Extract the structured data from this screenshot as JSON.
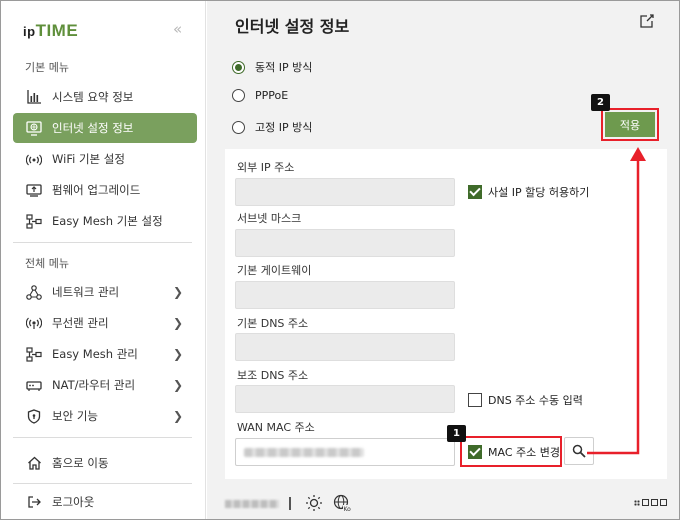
{
  "brand": {
    "ip": "ip",
    "time": "TIME"
  },
  "sidebar": {
    "basic_label": "기본 메뉴",
    "basic_items": [
      {
        "label": "시스템 요약 정보",
        "icon": "chart-icon"
      },
      {
        "label": "인터넷 설정 정보",
        "icon": "globe-icon",
        "active": true
      },
      {
        "label": "WiFi 기본 설정",
        "icon": "wifi-icon"
      },
      {
        "label": "펌웨어 업그레이드",
        "icon": "upgrade-icon"
      },
      {
        "label": "Easy Mesh 기본 설정",
        "icon": "mesh-icon"
      }
    ],
    "all_label": "전체 메뉴",
    "all_items": [
      {
        "label": "네트워크 관리",
        "icon": "network-icon"
      },
      {
        "label": "무선랜 관리",
        "icon": "wireless-icon"
      },
      {
        "label": "Easy Mesh 관리",
        "icon": "mesh-icon"
      },
      {
        "label": "NAT/라우터 관리",
        "icon": "router-icon"
      },
      {
        "label": "보안 기능",
        "icon": "shield-icon"
      }
    ],
    "home_label": "홈으로 이동",
    "logout_label": "로그아웃"
  },
  "main": {
    "title": "인터넷 설정 정보",
    "connection_modes": [
      {
        "label": "동적 IP 방식",
        "selected": true
      },
      {
        "label": "PPPoE",
        "selected": false
      },
      {
        "label": "고정 IP 방식",
        "selected": false
      }
    ],
    "apply_label": "적용",
    "fields": {
      "external_ip": "외부 IP 주소",
      "subnet": "서브넷 마스크",
      "gateway": "기본 게이트웨이",
      "dns1": "기본 DNS 주소",
      "dns2": "보조 DNS 주소",
      "wan_mac": "WAN MAC 주소"
    },
    "checks": {
      "private_ip": "사설 IP 할당 허용하기",
      "dns_manual": "DNS 주소 수동 입력",
      "mac_change": "MAC 주소 변경"
    }
  },
  "annotations": {
    "step1": "1",
    "step2": "2",
    "accent_color": "#e8202a"
  },
  "colors": {
    "brand_green": "#7aa05e",
    "dark_green": "#3f6b2a"
  }
}
